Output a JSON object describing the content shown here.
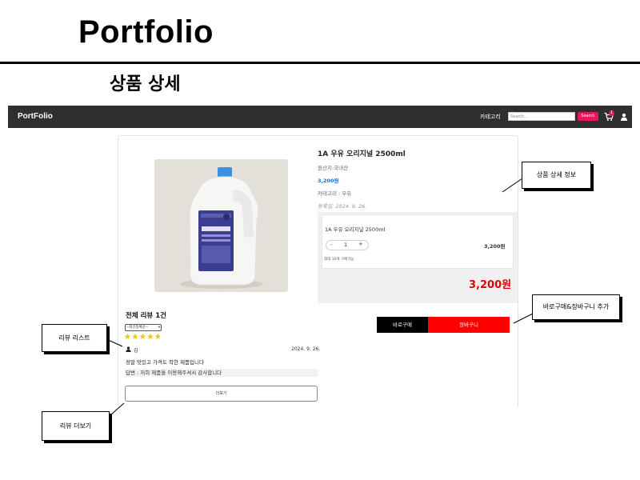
{
  "slide": {
    "title": "Portfolio",
    "subtitle": "상품 상세"
  },
  "navbar": {
    "brand": "PortFolio",
    "category_label": "카테고리",
    "search_placeholder": "Search...",
    "search_button": "Search",
    "cart_count": "1",
    "icons": [
      "cart-icon",
      "user-icon"
    ]
  },
  "product": {
    "name": "1A 우유 오리지널 2500ml",
    "origin": "원산지:국내산",
    "price": "3,200원",
    "category": "카테고리 : 우유",
    "registered": "등록일: 2024. 9. 26."
  },
  "option": {
    "name": "1A 우유 오리지널 2500ml",
    "minus": "-",
    "quantity": "1",
    "plus": "+",
    "price": "3,200원",
    "note": "최대 10개 구매가능",
    "total": "3,200원"
  },
  "actions": {
    "buy_now": "바로구매",
    "add_cart": "장바구니"
  },
  "reviews": {
    "title": "전체 리뷰 1건",
    "sort_selected": "--최신등록순--",
    "items": [
      {
        "stars": "★★★★★",
        "user": "김",
        "date": "2024. 9. 26.",
        "text": "정말 맛있고 가격도 착한 제품입니다",
        "reply": "답변 : 저희 제품을 이용해주셔서 감사합니다"
      }
    ],
    "more_button": "더보기"
  },
  "callouts": {
    "product_detail": "상품 상세 정보",
    "buy_cart": "바로구매&장바구니 추가",
    "review_list": "리뷰 리스트",
    "review_more": "리뷰 더보기"
  },
  "colors": {
    "navbar": "#2f2f2f",
    "accent_pink": "#e8175d",
    "price_blue": "#1a6fd6",
    "total_red": "#e00000",
    "cart_red": "#ff0000",
    "star": "#f2c200"
  }
}
